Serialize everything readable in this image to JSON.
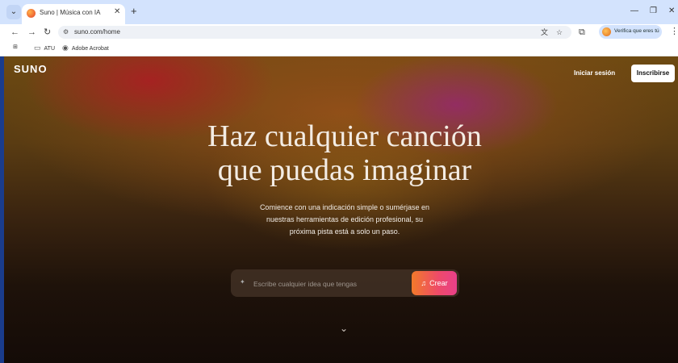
{
  "browser": {
    "tab": {
      "title": "Suno | Música con IA"
    },
    "url": "suno.com/home",
    "profile_label": "Verifica que eres tú",
    "bookmarks": [
      {
        "label": "ATU"
      },
      {
        "label": "Adobe Acrobat"
      }
    ],
    "icons": {
      "tab_menu": "chevron-down-icon",
      "back": "arrow-left-icon",
      "forward": "arrow-right-icon",
      "reload": "reload-icon",
      "translate": "translate-icon",
      "star": "star-icon",
      "extensions": "puzzle-icon"
    }
  },
  "site": {
    "logo": "SUNO",
    "login_label": "Iniciar sesión",
    "signup_label": "Inscribirse",
    "hero_title": "Haz cualquier canción que puedas imaginar",
    "hero_subtitle": "Comience con una indicación simple o sumérjase en nuestras herramientas de edición profesional, su próxima pista está a solo un paso.",
    "prompt_placeholder": "Escribe cualquier idea que tengas",
    "create_label": "Crear",
    "colors": {
      "accent_start": "#f27a2a",
      "accent_end": "#e8408a",
      "background_dark": "#140b07"
    }
  }
}
